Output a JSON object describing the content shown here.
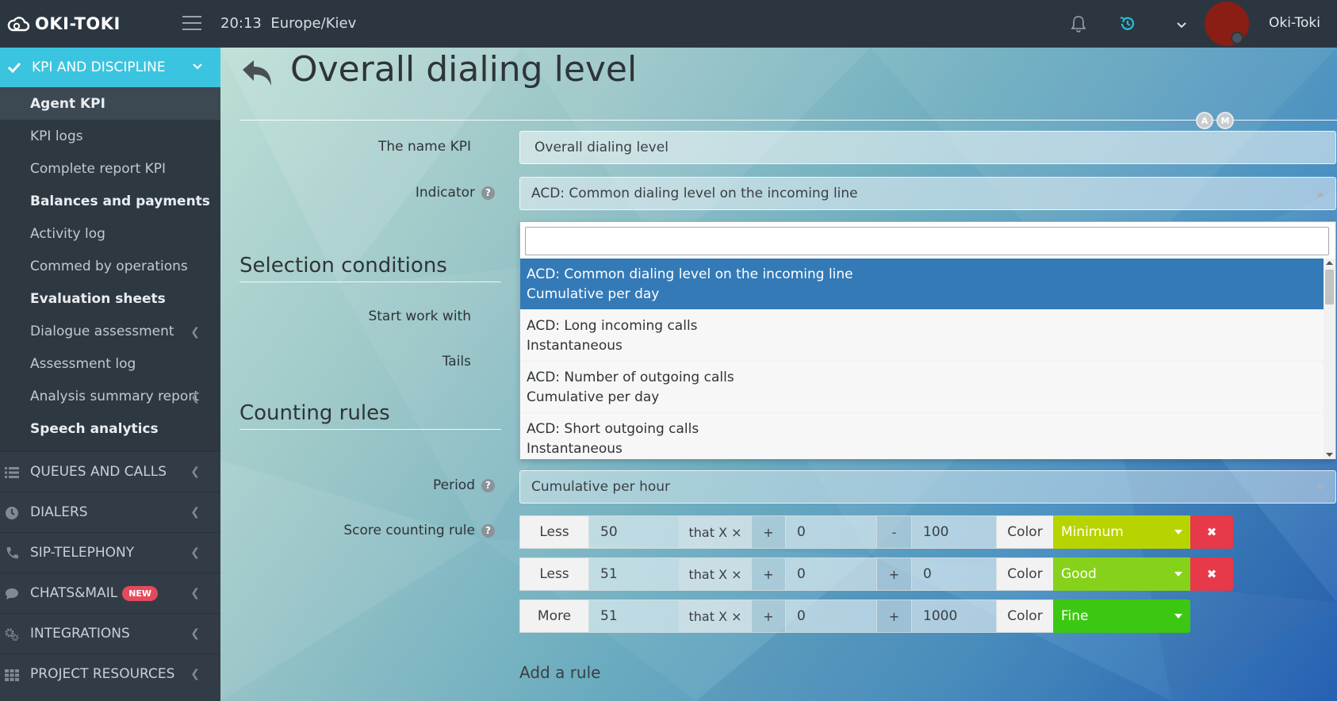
{
  "app": {
    "logo_text": "OKI-TOKI",
    "time": "20:13",
    "timezone": "Europe/Kiev",
    "username": "Oki-Toki"
  },
  "sidebar": {
    "active_group": "KPI AND DISCIPLINE",
    "items": [
      {
        "label": "Agent KPI",
        "bold": true,
        "selected": true
      },
      {
        "label": "KPI logs"
      },
      {
        "label": "Complete report KPI"
      },
      {
        "label": "Balances and payments",
        "bold": true
      },
      {
        "label": "Activity log"
      },
      {
        "label": "Commed by operations"
      },
      {
        "label": "Evaluation sheets",
        "bold": true
      },
      {
        "label": "Dialogue assessment",
        "arrow": true
      },
      {
        "label": "Assessment log"
      },
      {
        "label": "Analysis summary report",
        "arrow": true
      },
      {
        "label": "Speech analytics",
        "bold": true
      }
    ],
    "groups": [
      {
        "label": "QUEUES AND CALLS",
        "icon": "list-icon"
      },
      {
        "label": "DIALERS",
        "icon": "clock-icon"
      },
      {
        "label": "SIP-TELEPHONY",
        "icon": "phone-icon"
      },
      {
        "label": "CHATS&MAIL",
        "icon": "chat-icon",
        "badge": "NEW"
      },
      {
        "label": "INTEGRATIONS",
        "icon": "gears-icon"
      },
      {
        "label": "PROJECT RESOURCES",
        "icon": "grid-icon"
      }
    ]
  },
  "page": {
    "title": "Overall dialing level",
    "badges": [
      "A",
      "M"
    ]
  },
  "form": {
    "name_label": "The name KPI",
    "name_value": "Overall dialing level",
    "indicator_label": "Indicator",
    "indicator_value": "ACD: Common dialing level on the incoming line",
    "selection_title": "Selection conditions",
    "start_work_label": "Start work with",
    "tails_label": "Tails",
    "counting_title": "Counting rules",
    "period_label": "Period",
    "period_value": "Cumulative per hour",
    "score_label": "Score counting rule",
    "add_rule": "Add a rule"
  },
  "dropdown": {
    "options": [
      {
        "line1": "ACD: Common dialing level on the incoming line",
        "line2": "Cumulative per day",
        "highlighted": true
      },
      {
        "line1": "ACD: Long incoming calls",
        "line2": "Instantaneous"
      },
      {
        "line1": "ACD: Number of outgoing calls",
        "line2": "Cumulative per day"
      },
      {
        "line1": "ACD: Short outgoing calls",
        "line2": "Instantaneous"
      }
    ]
  },
  "rules": [
    {
      "compare": "Less",
      "value": "50",
      "that": "that X ×",
      "op1": "+",
      "v1": "0",
      "op2": "-",
      "v2": "100",
      "color_label": "Color",
      "color_value": "Minimum",
      "color_hex": "#b8d400",
      "deletable": true
    },
    {
      "compare": "Less",
      "value": "51",
      "that": "that X ×",
      "op1": "+",
      "v1": "0",
      "op2": "+",
      "v2": "0",
      "color_label": "Color",
      "color_value": "Good",
      "color_hex": "#86d21a",
      "deletable": true
    },
    {
      "compare": "More",
      "value": "51",
      "that": "that X ×",
      "op1": "+",
      "v1": "0",
      "op2": "+",
      "v2": "1000",
      "color_label": "Color",
      "color_value": "Fine",
      "color_hex": "#3cc812",
      "deletable": false
    }
  ],
  "colors": {
    "accent": "#3bc4df",
    "highlight": "#337ab7",
    "delete": "#e6394a"
  }
}
